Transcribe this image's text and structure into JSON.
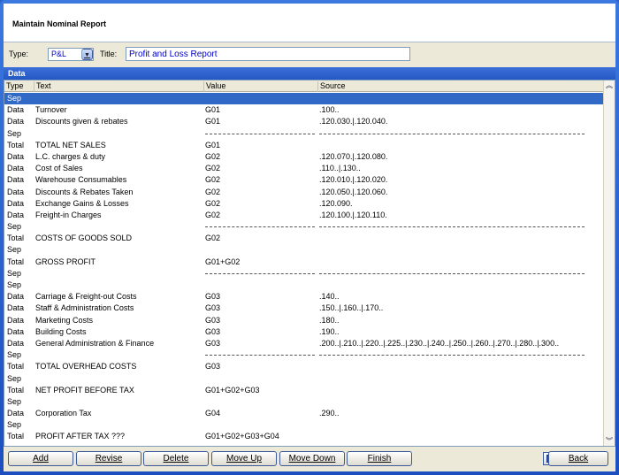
{
  "window": {
    "title": "Maintain Nominal Report"
  },
  "form": {
    "type_label": "Type:",
    "type_value": "P&L",
    "title_label": "Title:",
    "title_value": "Profit and Loss  Report"
  },
  "section": {
    "header": "Data"
  },
  "table": {
    "columns": [
      "Type",
      "Text",
      "Value",
      "Source"
    ],
    "rows": [
      {
        "type": "Sep",
        "text": "",
        "value": "",
        "source": "",
        "selected": true
      },
      {
        "type": "Data",
        "text": "Turnover",
        "value": "G01",
        "source": ".100.."
      },
      {
        "type": "Data",
        "text": "Discounts given & rebates",
        "value": "G01",
        "source": ".120.030.|.120.040."
      },
      {
        "type": "Sep",
        "text": "",
        "value": "",
        "source": "",
        "dash": true
      },
      {
        "type": "Total",
        "text": "TOTAL NET SALES",
        "value": "G01",
        "source": ""
      },
      {
        "type": "Data",
        "text": "L.C. charges & duty",
        "value": "G02",
        "source": ".120.070.|.120.080."
      },
      {
        "type": "Data",
        "text": "Cost of Sales",
        "value": "G02",
        "source": ".110..|.130.."
      },
      {
        "type": "Data",
        "text": "Warehouse Consumables",
        "value": "G02",
        "source": ".120.010.|.120.020."
      },
      {
        "type": "Data",
        "text": "Discounts & Rebates Taken",
        "value": "G02",
        "source": ".120.050.|.120.060."
      },
      {
        "type": "Data",
        "text": "Exchange Gains & Losses",
        "value": "G02",
        "source": ".120.090."
      },
      {
        "type": "Data",
        "text": "Freight-in Charges",
        "value": "G02",
        "source": ".120.100.|.120.110."
      },
      {
        "type": "Sep",
        "text": "",
        "value": "",
        "source": "",
        "dash": true
      },
      {
        "type": "Total",
        "text": "COSTS OF GOODS SOLD",
        "value": "G02",
        "source": ""
      },
      {
        "type": "Sep",
        "text": "",
        "value": "",
        "source": ""
      },
      {
        "type": "Total",
        "text": "GROSS PROFIT",
        "value": "G01+G02",
        "source": ""
      },
      {
        "type": "Sep",
        "text": "",
        "value": "",
        "source": "",
        "dash": true
      },
      {
        "type": "Sep",
        "text": "",
        "value": "",
        "source": ""
      },
      {
        "type": "Data",
        "text": "Carriage & Freight-out Costs",
        "value": "G03",
        "source": ".140.."
      },
      {
        "type": "Data",
        "text": "Staff & Administration Costs",
        "value": "G03",
        "source": ".150..|.160..|.170.."
      },
      {
        "type": "Data",
        "text": "Marketing Costs",
        "value": "G03",
        "source": ".180.."
      },
      {
        "type": "Data",
        "text": "Building Costs",
        "value": "G03",
        "source": ".190.."
      },
      {
        "type": "Data",
        "text": "General Administration & Finance",
        "value": "G03",
        "source": ".200..|.210..|.220..|.225..|.230..|.240..|.250..|.260..|.270..|.280..|.300.."
      },
      {
        "type": "Sep",
        "text": "",
        "value": "",
        "source": "",
        "dash": true
      },
      {
        "type": "Total",
        "text": "TOTAL OVERHEAD COSTS",
        "value": "G03",
        "source": ""
      },
      {
        "type": "Sep",
        "text": "",
        "value": "",
        "source": ""
      },
      {
        "type": "Total",
        "text": "NET PROFIT BEFORE TAX",
        "value": "G01+G02+G03",
        "source": ""
      },
      {
        "type": "Sep",
        "text": "",
        "value": "",
        "source": ""
      },
      {
        "type": "Data",
        "text": "Corporation Tax",
        "value": "G04",
        "source": ".290.."
      },
      {
        "type": "Sep",
        "text": "",
        "value": "",
        "source": ""
      },
      {
        "type": "Total",
        "text": "PROFIT AFTER TAX  ???",
        "value": "G01+G02+G03+G04",
        "source": ""
      }
    ]
  },
  "buttons": {
    "add": "Add",
    "revise": "Revise",
    "delete": "Delete",
    "move_up": "Move Up",
    "move_down": "Move Down",
    "finish": "Finish",
    "back": "Back"
  },
  "icons": {
    "combo_arrow": "chevron-down-icon",
    "scroll_up": "double-chevron-up-icon",
    "scroll_down": "double-chevron-down-icon",
    "help": "help-icon"
  },
  "colors": {
    "selected_row": "#3169c6",
    "header_blue": "#2458c4",
    "field_text": "#0000cc"
  }
}
